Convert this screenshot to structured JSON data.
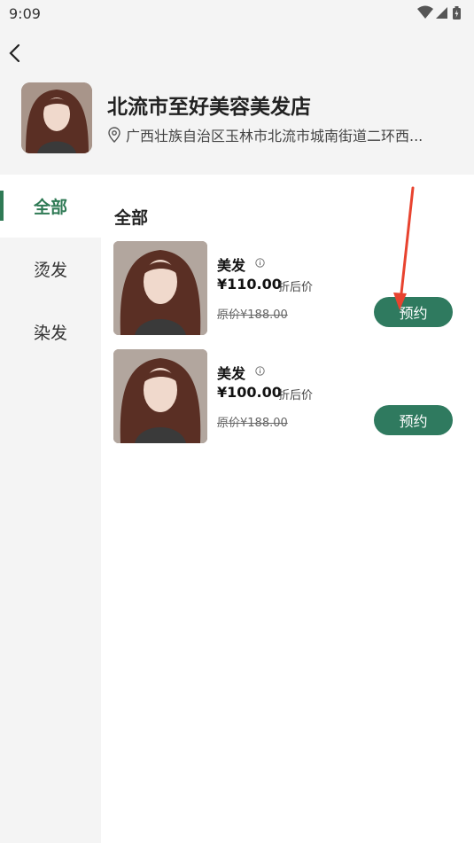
{
  "status_bar": {
    "time": "9:09"
  },
  "shop": {
    "name": "北流市至好美容美发店",
    "address": "广西壮族自治区玉林市北流市城南街道二环西..."
  },
  "sidebar": {
    "items": [
      {
        "label": "全部",
        "active": true
      },
      {
        "label": "烫发",
        "active": false
      },
      {
        "label": "染发",
        "active": false
      }
    ]
  },
  "content": {
    "section_title": "全部",
    "services": [
      {
        "name": "美发",
        "price": "¥110.00",
        "price_note": "折后价",
        "original": "原价¥188.00",
        "book_label": "预约"
      },
      {
        "name": "美发",
        "price": "¥100.00",
        "price_note": "折后价",
        "original": "原价¥188.00",
        "book_label": "预约"
      }
    ]
  },
  "colors": {
    "accent": "#2f7a55",
    "button": "#2f7a5f",
    "annotation_arrow": "#e8432f"
  }
}
